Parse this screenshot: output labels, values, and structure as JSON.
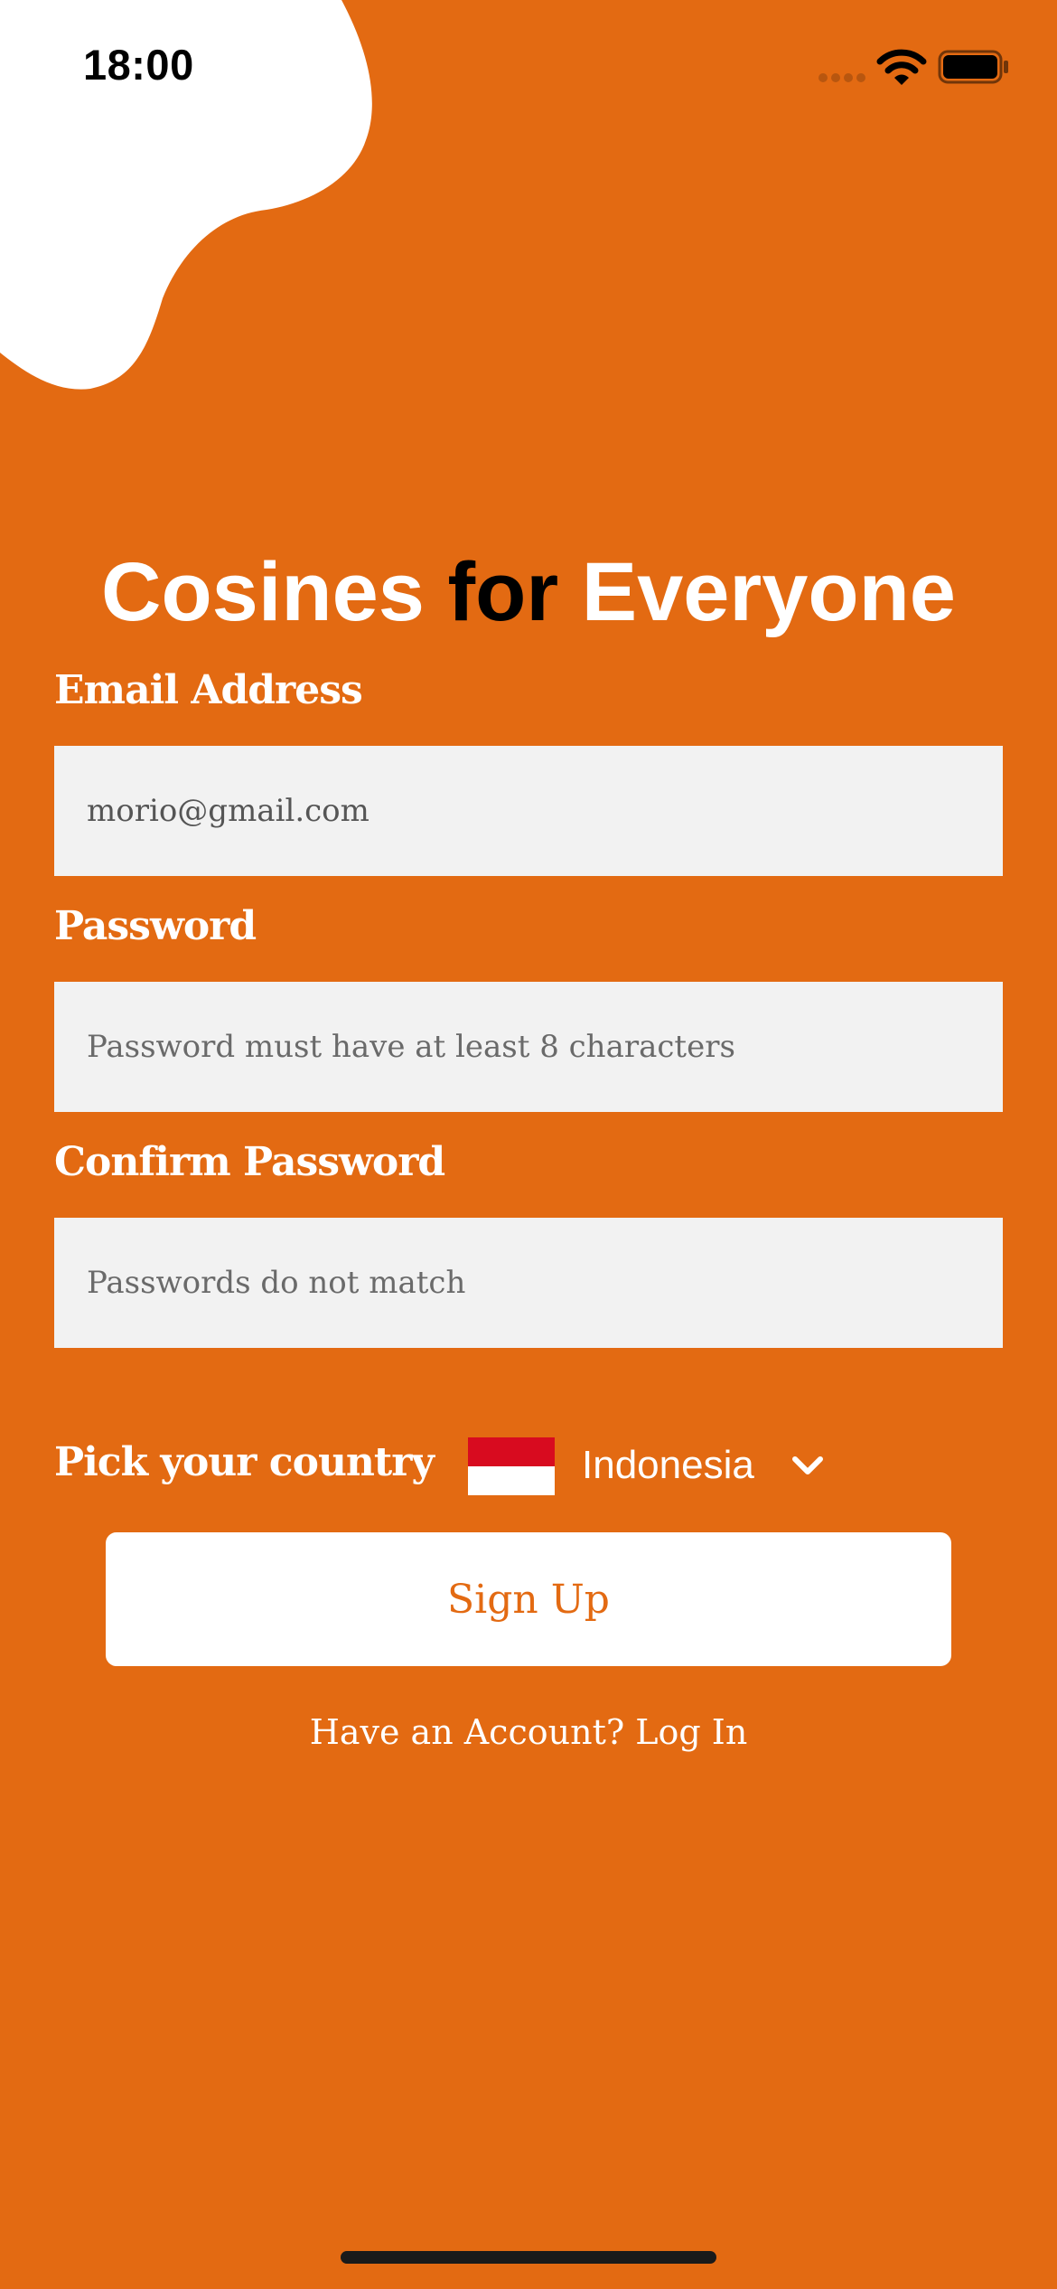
{
  "status_bar": {
    "time": "18:00"
  },
  "header": {
    "title_part1": "Cosines ",
    "title_part2": "for",
    "title_part3": " Everyone"
  },
  "form": {
    "email": {
      "label": "Email Address",
      "value": "morio@gmail.com",
      "placeholder": ""
    },
    "password": {
      "label": "Password",
      "value": "",
      "placeholder": "Password must have at least 8 characters"
    },
    "confirm_password": {
      "label": "Confirm Password",
      "value": "",
      "placeholder": "Passwords do not match"
    },
    "country": {
      "label": "Pick your country",
      "selected": "Indonesia",
      "flag_icon": "indonesia-flag-icon"
    },
    "signup_label": "Sign Up",
    "login_prompt": "Have an Account? Log In"
  },
  "colors": {
    "background": "#E36A12",
    "field_background": "#F2F2F2",
    "button_background": "#FFFFFF",
    "button_text": "#E36A12",
    "flag_red": "#D80B1F"
  }
}
